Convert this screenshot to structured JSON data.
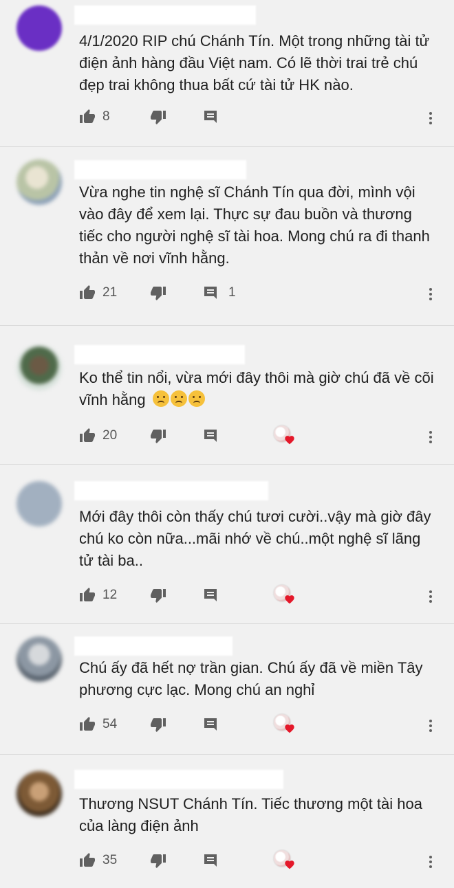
{
  "comments": [
    {
      "text": "4/1/2020 RIP chú Chánh Tín. Một trong những tài tử điện ảnh hàng đầu Việt nam. Có lẽ thời trai trẻ chú đẹp trai không thua bất cứ tài tử HK nào.",
      "likes": "8",
      "replies": "",
      "avatar_color": "#6a2fc4"
    },
    {
      "text": "Vừa nghe tin nghệ sĩ Chánh Tín qua đời, mình vội vào đây để xem lại. Thực sự đau buồn và thương tiếc cho người nghệ sĩ tài hoa. Mong chú ra đi thanh thản về nơi vĩnh hằng.",
      "likes": "21",
      "replies": "1",
      "avatar_color": "#b9c4a6"
    },
    {
      "text": "Ko thể tin nổi, vừa mới đây thôi mà giờ chú đã về cõi vĩnh hằng",
      "emoji_after": [
        "😢",
        "😢",
        "😢"
      ],
      "likes": "20",
      "replies": "",
      "avatar_color": "#4f6a4a"
    },
    {
      "text": "Mới đây thôi còn thấy chú tươi cười..vậy mà giờ đây chú ko còn nữa...mãi nhớ về chú..một nghệ sĩ lãng tử tài ba..",
      "likes": "12",
      "replies": "",
      "avatar_color": "#a2b0c0"
    },
    {
      "text": "Chú ấy đã hết nợ trần gian. Chú ấy đã về miền Tây phương cực lạc. Mong chú an nghỉ",
      "likes": "54",
      "replies": "",
      "avatar_color": "#8c97a3"
    },
    {
      "text": "Thương NSUT Chánh Tín. Tiếc thương một tài hoa của làng điện ảnh",
      "likes": "35",
      "replies": "",
      "avatar_color": "#7d5a36"
    }
  ],
  "icons": {
    "like": "thumbs-up-icon",
    "dislike": "thumbs-down-icon",
    "reply": "reply-icon",
    "more": "more-vert-icon",
    "creator_heart": "creator-heart-icon"
  },
  "colors": {
    "background": "#f1f1f1",
    "text": "#202020",
    "icon": "#606060",
    "heart": "#e4182a"
  }
}
